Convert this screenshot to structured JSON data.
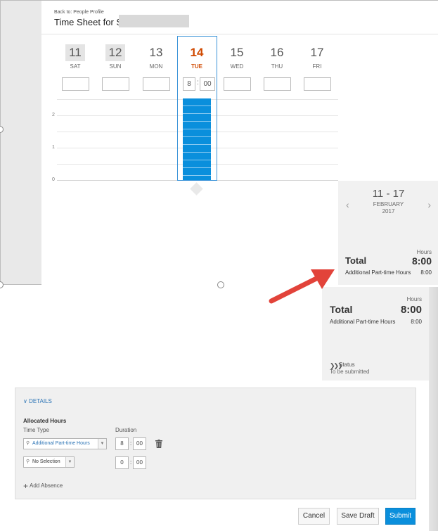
{
  "header": {
    "back_link": "Back to: People Profile",
    "title": "Time Sheet for S"
  },
  "days": [
    {
      "num": "11",
      "name": "SAT",
      "weekend": true
    },
    {
      "num": "12",
      "name": "SUN",
      "weekend": true
    },
    {
      "num": "13",
      "name": "MON"
    },
    {
      "num": "14",
      "name": "TUE",
      "today": true
    },
    {
      "num": "15",
      "name": "WED"
    },
    {
      "num": "16",
      "name": "THU"
    },
    {
      "num": "17",
      "name": "FRI"
    }
  ],
  "today_entry": {
    "hours": "8",
    "minutes": "00"
  },
  "chart_axis": {
    "ticks": [
      "2",
      "1",
      "0"
    ]
  },
  "week": {
    "range": "11 - 17",
    "month": "FEBRUARY",
    "year": "2017"
  },
  "totals": {
    "hours_label": "Hours",
    "total_label": "Total",
    "total_value": "8:00",
    "line_label": "Additional Part-time Hours",
    "line_value": "8:00"
  },
  "status": {
    "label": "Status",
    "value": "To be submitted"
  },
  "details": {
    "toggle_label": "DETAILS",
    "section_title": "Allocated Hours",
    "col_time_type": "Time Type",
    "col_duration": "Duration",
    "rows": [
      {
        "type": "Additional Part-time Hours",
        "hours": "8",
        "minutes": "00"
      },
      {
        "type": "No Selection",
        "hours": "0",
        "minutes": "00"
      }
    ],
    "add_absence": "Add Absence"
  },
  "buttons": {
    "cancel": "Cancel",
    "save_draft": "Save Draft",
    "submit": "Submit"
  },
  "colors": {
    "accent": "#0a8fdc",
    "today": "#d04a02",
    "link": "#2a73b5",
    "arrow": "#e2433a"
  }
}
